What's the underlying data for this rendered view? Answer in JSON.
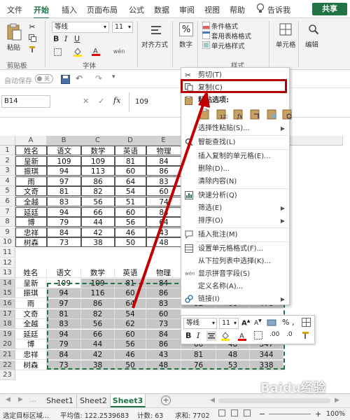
{
  "ribbon_tabs": [
    "文件",
    "开始",
    "插入",
    "页面布局",
    "公式",
    "数据",
    "审阅",
    "视图",
    "帮助"
  ],
  "active_tab": "开始",
  "tell_me": "告诉我",
  "share_label": "共享",
  "ribbon": {
    "paste_label": "粘贴",
    "clipboard_group": "剪贴板",
    "font_name": "等线",
    "font_size": "11",
    "font_group": "字体",
    "align_label": "对齐方式",
    "number_label": "数字",
    "cond_format": "条件格式",
    "table_format": "套用表格格式",
    "cell_style": "单元格样式",
    "styles_group": "样式",
    "cells_label": "单元格",
    "edit_label": "编辑"
  },
  "qat": {
    "autosave_label": "自动保存",
    "autosave_state": "关"
  },
  "formula_bar": {
    "name_box": "B14",
    "fx": "fx",
    "value": "109"
  },
  "columns": [
    "A",
    "B",
    "C",
    "D",
    "E"
  ],
  "table1": {
    "headers": [
      "姓名",
      "语文",
      "数学",
      "英语",
      "物理"
    ],
    "rows": [
      [
        "呈新",
        "109",
        "109",
        "81",
        "84"
      ],
      [
        "振琪",
        "94",
        "113",
        "60",
        "86"
      ],
      [
        "雨",
        "97",
        "86",
        "64",
        "83"
      ],
      [
        "文奇",
        "81",
        "82",
        "54",
        "60"
      ],
      [
        "全越",
        "83",
        "56",
        "51",
        "74"
      ],
      [
        "延廷",
        "94",
        "66",
        "60",
        "84"
      ],
      [
        "博",
        "79",
        "44",
        "56",
        "64"
      ],
      [
        "忠祥",
        "84",
        "42",
        "46",
        "43"
      ],
      [
        "树森",
        "73",
        "38",
        "50",
        "48"
      ]
    ]
  },
  "table2": {
    "headers": [
      "姓名",
      "语文",
      "数学",
      "英语",
      "物理"
    ],
    "rows": [
      [
        "呈新",
        "109",
        "109",
        "81",
        "84"
      ],
      [
        "振琪",
        "94",
        "116",
        "60",
        "86"
      ],
      [
        "雨",
        "97",
        "86",
        "64",
        "83"
      ],
      [
        "文奇",
        "81",
        "82",
        "54",
        "60"
      ],
      [
        "全越",
        "83",
        "56",
        "62",
        "73"
      ],
      [
        "延廷",
        "94",
        "66",
        "60",
        "84"
      ],
      [
        "博",
        "79",
        "44",
        "56",
        "86"
      ],
      [
        "忠祥",
        "84",
        "42",
        "46",
        "43"
      ],
      [
        "树森",
        "73",
        "38",
        "50",
        "48"
      ]
    ],
    "extra_visible": {
      "r16": [
        "82",
        "66",
        "478"
      ],
      "r20": [
        "66",
        "48",
        "347"
      ],
      "r21": [
        "81",
        "48",
        "344"
      ],
      "r22": [
        "76",
        "53",
        "338"
      ]
    }
  },
  "context_menu": {
    "cut": "剪切(T)",
    "copy": "复制(C)",
    "paste_options": "粘贴选项:",
    "paste_special": "选择性粘贴(S)...",
    "smart_lookup": "智能查找(L)",
    "insert_copied": "插入复制的单元格(E)...",
    "delete": "删除(D)...",
    "clear": "清除内容(N)",
    "quick_analysis": "快速分析(Q)",
    "filter": "筛选(E)",
    "sort": "排序(O)",
    "insert_comment": "插入批注(M)",
    "format_cells": "设置单元格格式(F)...",
    "pick_list": "从下拉列表中选择(K)...",
    "phonetic": "显示拼音字段(S)",
    "define_name": "定义名称(A)...",
    "link": "链接(I)"
  },
  "mini_toolbar": {
    "font": "等线",
    "size": "11"
  },
  "sheets": [
    "Sheet1",
    "Sheet2",
    "Sheet3"
  ],
  "active_sheet": "Sheet3",
  "status": {
    "mode": "选定目标区域...",
    "average": "平均值: 122.2539683",
    "count": "计数: 63",
    "sum": "求和: 7702",
    "zoom": "100%"
  },
  "watermark": "Baidu经验",
  "colors": {
    "accent": "#217346",
    "highlight_box": "#b30000",
    "arrow": "#c00000",
    "selection": "#c6c6c6"
  }
}
